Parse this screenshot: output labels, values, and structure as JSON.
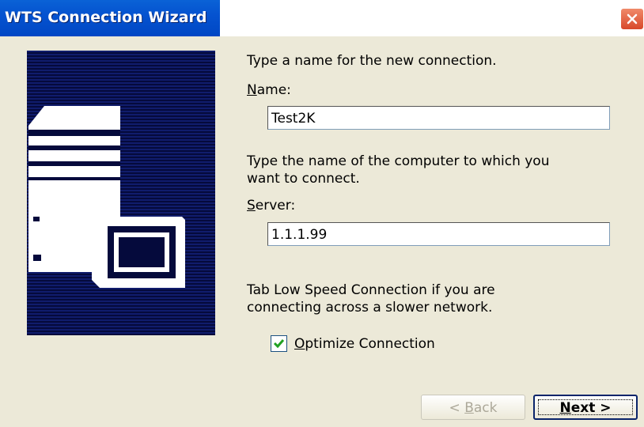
{
  "window": {
    "title": "WTS Connection Wizard"
  },
  "instructions": {
    "name_prompt": "Type a name for the new connection.",
    "server_prompt_line1": "Type the name of the computer to which you",
    "server_prompt_line2": "want to connect.",
    "speed_line1": "Tab Low Speed Connection if you are",
    "speed_line2": "connecting across a slower network."
  },
  "name_field": {
    "label_key": "N",
    "label_rest": "ame:",
    "value": "Test2K"
  },
  "server_field": {
    "label_key": "S",
    "label_rest": "erver:",
    "value": "1.1.1.99"
  },
  "optimize": {
    "label_key": "O",
    "label_rest": "ptimize Connection",
    "checked": true
  },
  "buttons": {
    "back_prefix": "< ",
    "back_key": "B",
    "back_rest": "ack",
    "next_key": "N",
    "next_rest": "ext >"
  },
  "colors": {
    "title_bar": "#0553d0",
    "art_bg": "#101c6c",
    "check": "#21a121",
    "close": "#d8482a"
  }
}
